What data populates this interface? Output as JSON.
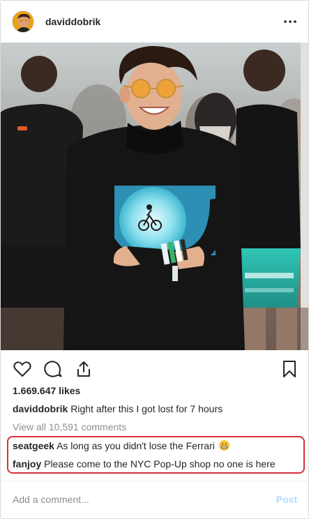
{
  "post": {
    "username": "daviddobrik",
    "likes": "1.669.647 likes",
    "caption": {
      "author": "daviddobrik",
      "text": "Right after this I got lost for 7 hours"
    },
    "view_all": "View all 10,591 comments",
    "comments": [
      {
        "author": "seatgeek",
        "text": "As long as you didn't lose the Ferrari"
      },
      {
        "author": "fanjoy",
        "text": "Please come to the NYC Pop-Up shop no one is here"
      }
    ]
  },
  "composer": {
    "placeholder": "Add a comment...",
    "post_label": "Post"
  },
  "icons": {
    "avatar": "avatar",
    "more": "more-horizontal-icon",
    "like": "heart-icon",
    "comment": "comment-bubble-icon",
    "share": "share-icon",
    "save": "bookmark-icon",
    "emoji": "grimacing-face-emoji"
  },
  "colors": {
    "highlight_border": "#d6323a",
    "post_button_disabled": "#b3dbff",
    "muted_text": "#8e8e8e"
  }
}
